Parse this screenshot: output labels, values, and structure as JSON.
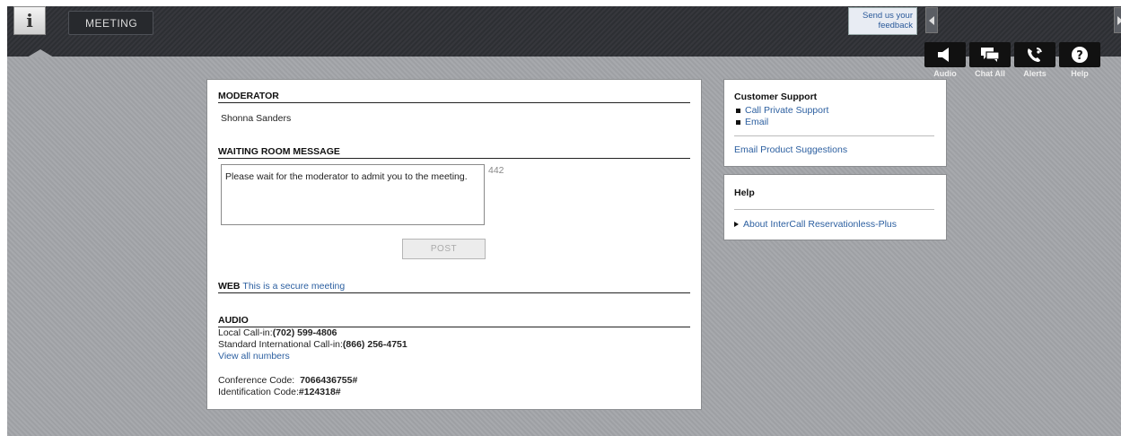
{
  "topbar": {
    "meeting_tab": "MEETING",
    "feedback": "Send us your\nfeedback"
  },
  "toolbar": {
    "items": [
      {
        "label": "Audio",
        "icon": "speaker-icon"
      },
      {
        "label": "Chat All",
        "icon": "chat-icon"
      },
      {
        "label": "Alerts",
        "icon": "phone-alert-icon"
      },
      {
        "label": "Help",
        "icon": "help-icon"
      }
    ]
  },
  "main": {
    "moderator_heading": "MODERATOR",
    "moderator_name": "Shonna Sanders",
    "waiting_heading": "WAITING ROOM MESSAGE",
    "waiting_message": "Please wait for the moderator to admit you to the meeting.",
    "char_count": "442",
    "post_label": "POST",
    "web_heading": "WEB",
    "web_secure": "This is a secure meeting",
    "audio_heading": "AUDIO",
    "local_label": "Local Call-in:",
    "local_number": "(702) 599-4806",
    "intl_label": "Standard International Call-in:",
    "intl_number": "(866) 256-4751",
    "view_all": "View all numbers",
    "conf_label": "Conference Code:",
    "conf_code": "7066436755#",
    "ident_label": "Identification Code:",
    "ident_code": "#124318#"
  },
  "support": {
    "title": "Customer Support",
    "links": [
      "Call Private Support",
      "Email"
    ],
    "suggestions": "Email Product Suggestions"
  },
  "help": {
    "title": "Help",
    "link": "About InterCall Reservationless-Plus"
  },
  "colors": {
    "link": "#2c5fa0",
    "background": "#a4a6aa",
    "topbar": "#2f3136"
  }
}
